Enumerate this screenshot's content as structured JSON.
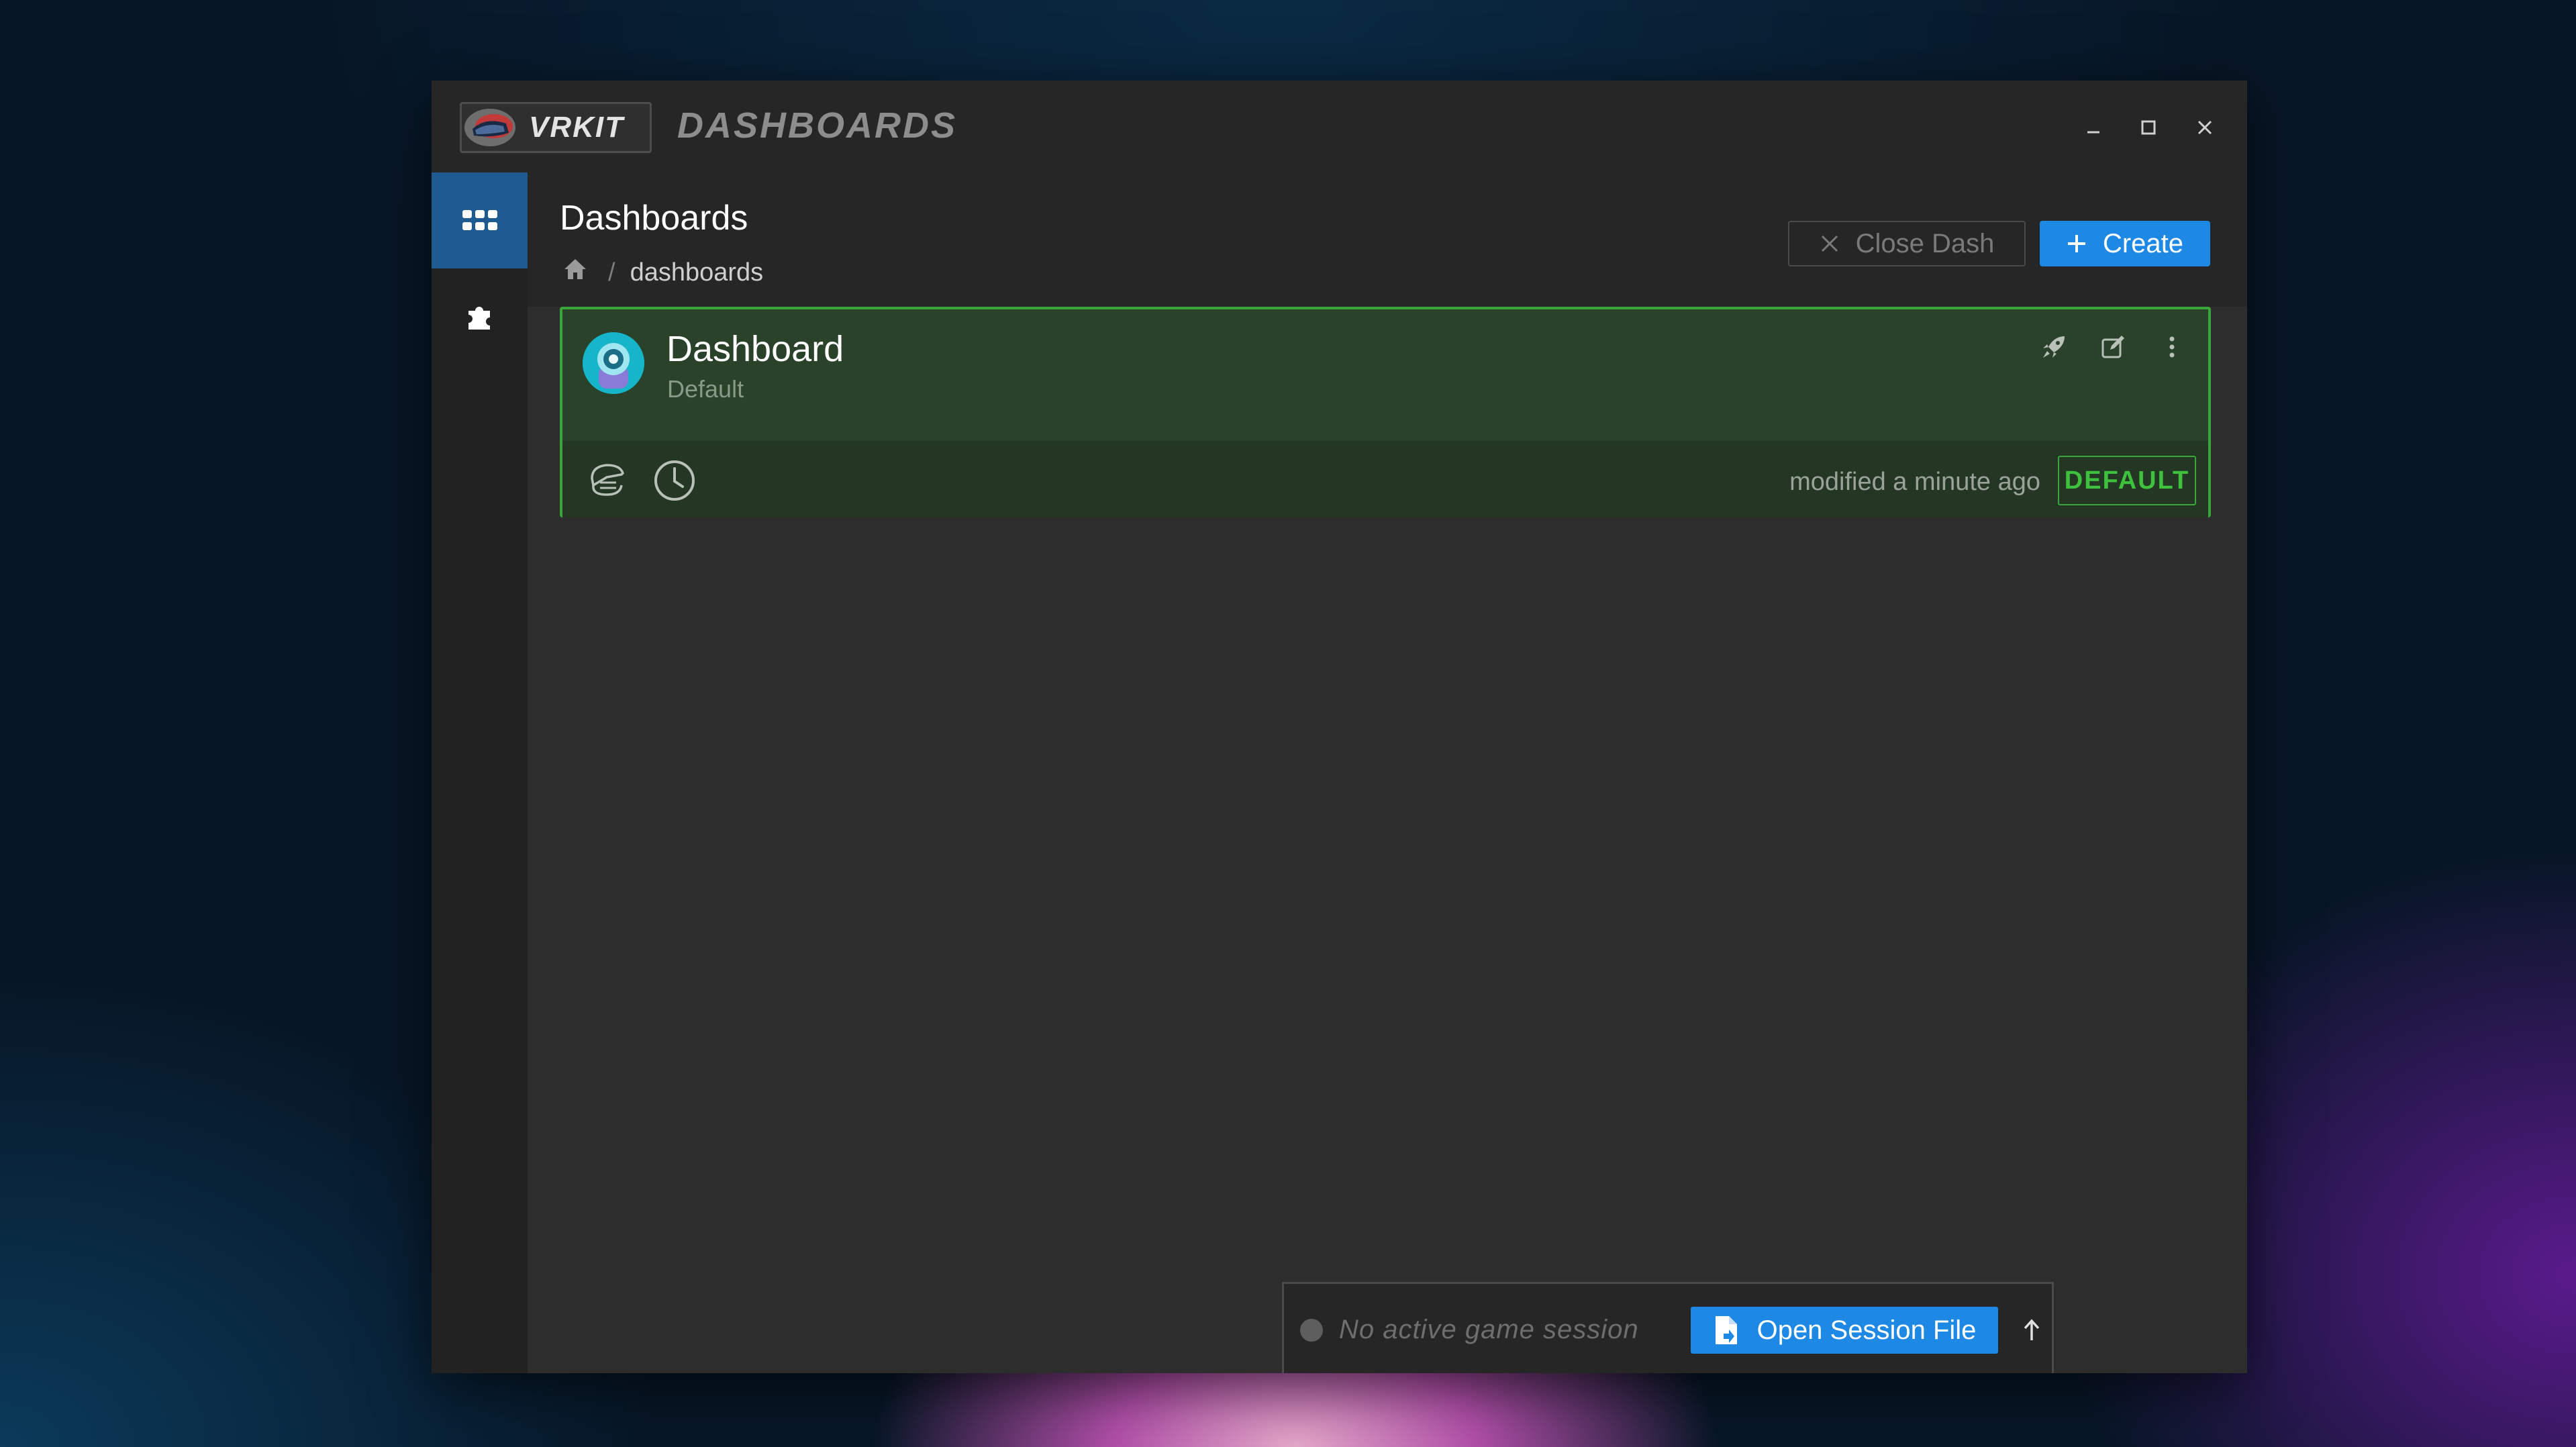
{
  "window": {
    "logo_text": "VRKIT",
    "app_name": "DASHBOARDS"
  },
  "sidebar": {
    "items": [
      {
        "name": "dashboards",
        "icon": "grid-icon",
        "active": true
      },
      {
        "name": "plugins",
        "icon": "puzzle-icon",
        "active": false
      }
    ]
  },
  "header": {
    "title": "Dashboards",
    "breadcrumb": {
      "separator": "/",
      "current": "dashboards"
    },
    "close_label": "Close Dash",
    "create_label": "Create"
  },
  "dashboards": [
    {
      "title": "Dashboard",
      "subtitle": "Default",
      "modified": "modified a minute ago",
      "badge": "DEFAULT"
    }
  ],
  "session": {
    "status": "No active game session",
    "open_label": "Open Session File"
  },
  "colors": {
    "accent": "#1e88e5",
    "sidebar_active": "#1e5b91",
    "success": "#3aa63a",
    "avatar": "#16b5c9"
  }
}
